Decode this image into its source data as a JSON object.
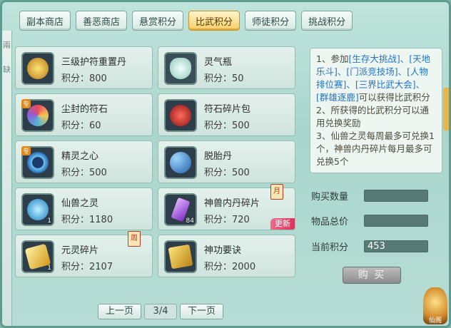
{
  "tabs": [
    "副本商店",
    "善恶商店",
    "悬赏积分",
    "比武积分",
    "师徒积分",
    "挑战积分"
  ],
  "active_tab": 3,
  "left_strip": [
    "兩",
    "缺"
  ],
  "items": [
    {
      "name": "三级护符重置丹",
      "points": "积分：800",
      "icon": "gold-amulet-icon",
      "color": "#d9a12b"
    },
    {
      "name": "灵气瓶",
      "points": "积分：50",
      "icon": "vase-icon",
      "color": "#bfe6dc"
    },
    {
      "name": "尘封的符石",
      "points": "积分：60",
      "icon": "rune-stone-icon",
      "color": "#4fb6d9",
      "tag": "专"
    },
    {
      "name": "符石碎片包",
      "points": "积分：500",
      "icon": "red-bag-icon",
      "color": "#c9302c"
    },
    {
      "name": "精灵之心",
      "points": "积分：500",
      "icon": "spirit-heart-icon",
      "color": "#5fa9e6",
      "tag": "专"
    },
    {
      "name": "脱胎丹",
      "points": "积分：500",
      "icon": "pills-icon",
      "color": "#3b8fd6"
    },
    {
      "name": "仙兽之灵",
      "points": "积分：1180",
      "icon": "beast-orb-icon",
      "color": "#2e9ee0",
      "count": "1"
    },
    {
      "name": "神兽内丹碎片",
      "points": "积分：720",
      "icon": "purple-crystal-icon",
      "color": "#9b59d6",
      "count": "84",
      "badge": "月",
      "new": "更新"
    },
    {
      "name": "元灵碎片",
      "points": "积分：2107",
      "icon": "gold-shard-icon",
      "color": "#e8b93a",
      "count": "1",
      "badge": "周"
    },
    {
      "name": "神功要诀",
      "points": "积分：2000",
      "icon": "golden-book-icon",
      "color": "#e3b224"
    }
  ],
  "description": {
    "l1a": "1、参加",
    "l1b": "[生存大挑战]、[天地乐斗]、[门派竞技场]、[人物排位赛]、[三界比武大会]、[群雄逐鹿]",
    "l1c": "可以获得比武积分",
    "l2": "2、所获得的比武积分可以通用兑换奖励",
    "l3": "3、仙兽之灵每周最多可兑换1个，神兽内丹碎片每月最多可兑换5个"
  },
  "form": {
    "qty_label": "购买数量",
    "total_label": "物品总价",
    "current_label": "当前积分",
    "current_value": "453"
  },
  "buy_label": "购 买",
  "pager": {
    "prev": "上一页",
    "page": "3/4",
    "next": "下一页"
  },
  "corner_label": "仙阁"
}
